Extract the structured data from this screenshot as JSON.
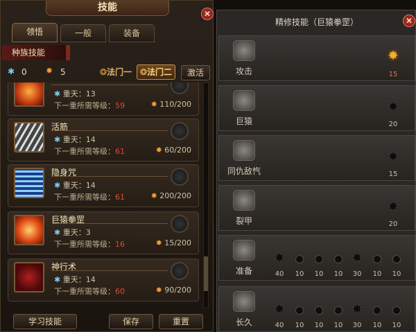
{
  "window_title": "技能",
  "tabs": [
    "领悟",
    "一般",
    "装备"
  ],
  "race_skills_label": "种族技能",
  "stats": {
    "snow_count": "0",
    "coin_count": "5"
  },
  "law_buttons": [
    "法门一",
    "法门二"
  ],
  "activate_label": "激活",
  "skills": [
    {
      "name": "",
      "level_label": "重天：13",
      "req_label": "下一重所需等级：",
      "req_value": "59",
      "cost": "110/200",
      "icon_color": "#d64c1c"
    },
    {
      "name": "活筋",
      "level_label": "重天：14",
      "req_label": "下一重所需等级：",
      "req_value": "61",
      "cost": "60/200",
      "icon_color": "#8c8c8c"
    },
    {
      "name": "隐身咒",
      "level_label": "重天：14",
      "req_label": "下一重所需等级：",
      "req_value": "61",
      "cost": "200/200",
      "icon_color": "#2a5aa8"
    },
    {
      "name": "巨猿拳罡",
      "level_label": "重天：3",
      "req_label": "下一重所需等级：",
      "req_value": "16",
      "cost": "15/200",
      "icon_color": "#d85a2a"
    },
    {
      "name": "神行术",
      "level_label": "重天：14",
      "req_label": "下一重所需等级：",
      "req_value": "60",
      "cost": "90/200",
      "icon_color": "#6a1414"
    }
  ],
  "footer_buttons": {
    "learn": "学习技能",
    "save": "保存",
    "reset": "重置"
  },
  "refine_panel": {
    "title": "精修技能（巨猿拳罡）",
    "rows": [
      {
        "label": "攻击",
        "values": [
          "15"
        ],
        "lit": [
          true
        ]
      },
      {
        "label": "巨猿",
        "values": [
          "20"
        ],
        "lit": [
          false
        ]
      },
      {
        "label": "同仇敌忾",
        "values": [
          "15"
        ],
        "lit": [
          false
        ]
      },
      {
        "label": "裂甲",
        "values": [
          "20"
        ],
        "lit": [
          false
        ]
      },
      {
        "label": "准备",
        "values": [
          "40",
          "10",
          "10",
          "10",
          "30",
          "10",
          "10"
        ],
        "lit": [
          false,
          false,
          false,
          false,
          false,
          false,
          false
        ]
      },
      {
        "label": "长久",
        "values": [
          "40",
          "10",
          "10",
          "10",
          "30",
          "10",
          "10"
        ],
        "lit": [
          false,
          false,
          false,
          false,
          false,
          false,
          false
        ]
      }
    ]
  },
  "colors": {
    "accent": "#f2b12e",
    "required_level": "#d84a3a",
    "close_button": "#c23b2a"
  }
}
